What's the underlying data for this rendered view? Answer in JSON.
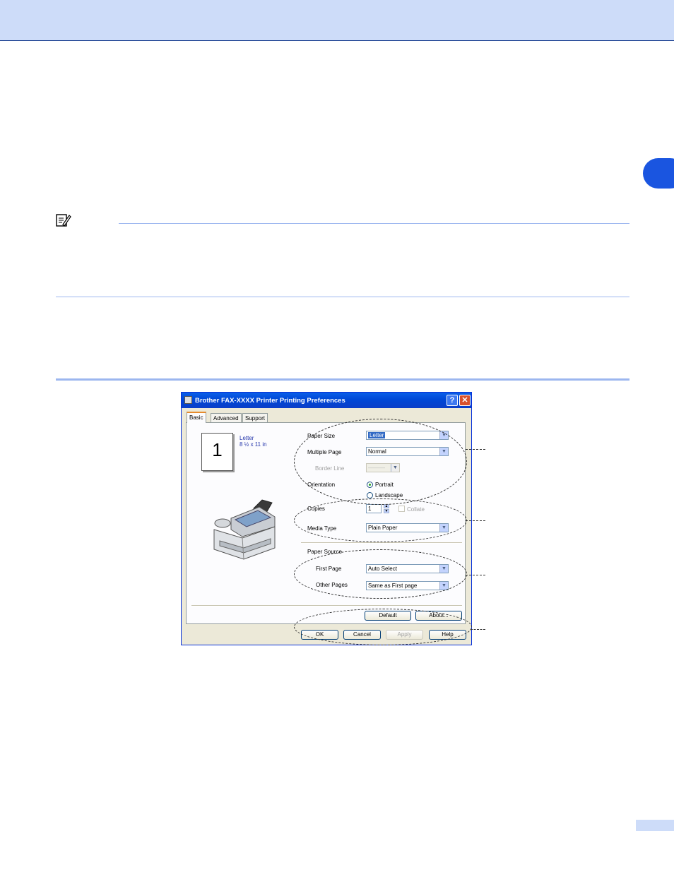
{
  "dialog": {
    "title": "Brother FAX-XXXX Printer Printing Preferences",
    "help_glyph": "?",
    "close_glyph": "✕",
    "tabs": [
      "Basic",
      "Advanced",
      "Support"
    ],
    "preview": {
      "page_number": "1",
      "paper_name": "Letter",
      "paper_dims": "8 ½ x 11 in"
    },
    "fields": {
      "paper_size_label": "Paper Size",
      "paper_size_value": "Letter",
      "multiple_page_label": "Multiple Page",
      "multiple_page_value": "Normal",
      "border_line_label": "Border Line",
      "border_line_value": "———",
      "orientation_label": "Orientation",
      "portrait_label": "Portrait",
      "landscape_label": "Landscape",
      "copies_label": "Copies",
      "copies_value": "1",
      "collate_label": "Collate",
      "media_type_label": "Media Type",
      "media_type_value": "Plain Paper",
      "paper_source_label": "Paper Source",
      "first_page_label": "First Page",
      "first_page_value": "Auto Select",
      "other_pages_label": "Other Pages",
      "other_pages_value": "Same as First page"
    },
    "buttons": {
      "default": "Default",
      "about": "About...",
      "ok": "OK",
      "cancel": "Cancel",
      "apply": "Apply",
      "help": "Help"
    }
  },
  "colors": {
    "band": "#cddcf9",
    "chapter_tab": "#1a55e0",
    "rule": "#9cb6ef"
  }
}
